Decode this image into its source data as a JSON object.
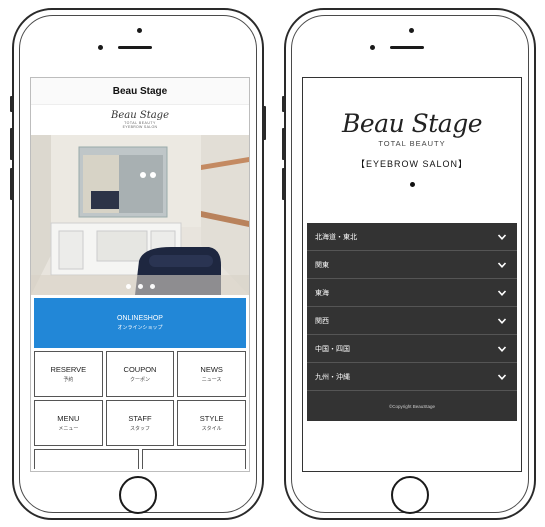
{
  "left_phone": {
    "header_title": "Beau Stage",
    "logo": {
      "script": "Beau Stage",
      "line1": "TOTAL BEAUTY",
      "line2": "EYEBROW SALON"
    },
    "carousel": {
      "dots": 3
    },
    "online_shop": {
      "label_en": "ONLINESHOP",
      "label_jp": "オンラインショップ"
    },
    "menu": [
      {
        "en": "RESERVE",
        "jp": "予約"
      },
      {
        "en": "COUPON",
        "jp": "クーポン"
      },
      {
        "en": "NEWS",
        "jp": "ニュース"
      },
      {
        "en": "MENU",
        "jp": "メニュー"
      },
      {
        "en": "STAFF",
        "jp": "スタッフ"
      },
      {
        "en": "STYLE",
        "jp": "スタイル"
      }
    ]
  },
  "right_phone": {
    "logo": {
      "script": "Beau Stage",
      "sub": "TOTAL BEAUTY",
      "salon": "【EYEBROW SALON】"
    },
    "regions": [
      {
        "name": "北海道・東北"
      },
      {
        "name": "関東"
      },
      {
        "name": "東海"
      },
      {
        "name": "関西"
      },
      {
        "name": "中国・四国"
      },
      {
        "name": "九州・沖縄"
      }
    ],
    "copyright": "©Copyright BeauStage"
  },
  "colors": {
    "accent_blue": "#2287d7",
    "dark_panel": "#333333"
  }
}
